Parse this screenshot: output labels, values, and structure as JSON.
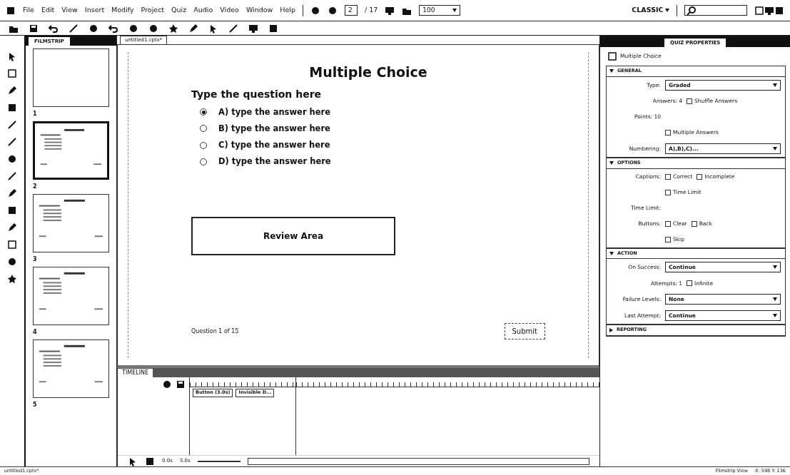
{
  "menu_bar": {
    "menus": [
      "File",
      "Edit",
      "View",
      "Insert",
      "Modify",
      "Project",
      "Quiz",
      "Audio",
      "Video",
      "Window",
      "Help"
    ],
    "slide_number": "2",
    "slide_total": "/ 17",
    "zoom": "100",
    "workspace": "CLASSIC"
  },
  "filmstrip": {
    "tab": "FILMSTRIP",
    "slides": [
      {
        "number": "1",
        "selected": false,
        "kind": "blank"
      },
      {
        "number": "2",
        "selected": true,
        "kind": "quiz"
      },
      {
        "number": "3",
        "selected": false,
        "kind": "quiz"
      },
      {
        "number": "4",
        "selected": false,
        "kind": "quiz"
      },
      {
        "number": "5",
        "selected": false,
        "kind": "quiz"
      }
    ]
  },
  "document_tab": "untitled1.cptx*",
  "slide": {
    "title": "Multiple Choice",
    "question": "Type the question here",
    "answers": [
      {
        "label": "A) type the answer here",
        "selected": true
      },
      {
        "label": "B) type the answer here",
        "selected": false
      },
      {
        "label": "C) type the answer here",
        "selected": false
      },
      {
        "label": "D) type the answer here",
        "selected": false
      }
    ],
    "review_area": "Review Area",
    "progress": "Question 1 of 15",
    "submit": "Submit"
  },
  "timeline": {
    "tab": "TIMELINE",
    "bars": [
      "Button (3.0s)",
      "Invisible D..."
    ],
    "time": "0.0s",
    "duration": "3.0s"
  },
  "quiz_properties": {
    "tab": "QUIZ PROPERTIES",
    "title": "Multiple Choice",
    "sections": [
      {
        "name": "GENERAL",
        "expanded": true,
        "rows": [
          {
            "kind": "select",
            "label": "Type:",
            "value": "Graded"
          },
          {
            "kind": "mixed",
            "label": "Answers: 4",
            "items": [
              {
                "label": "Shuffle Answers",
                "checked": false
              }
            ]
          },
          {
            "kind": "text",
            "label": "Points: 10"
          },
          {
            "kind": "checks",
            "items": [
              {
                "label": "Multiple Answers",
                "checked": false
              }
            ]
          },
          {
            "kind": "select",
            "label": "Numbering:",
            "value": "A),B),C)..."
          }
        ]
      },
      {
        "name": "OPTIONS",
        "expanded": true,
        "rows": [
          {
            "kind": "checks",
            "label": "Captions:",
            "items": [
              {
                "label": "Correct",
                "checked": false
              },
              {
                "label": "Incomplete",
                "checked": false
              }
            ]
          },
          {
            "kind": "checks",
            "items": [
              {
                "label": "Time Limit",
                "checked": false
              }
            ]
          },
          {
            "kind": "text",
            "label": "Time Limit:"
          },
          {
            "kind": "checks",
            "label": "Buttons:",
            "items": [
              {
                "label": "Clear",
                "checked": false
              },
              {
                "label": "Back",
                "checked": false
              }
            ]
          },
          {
            "kind": "checks",
            "items": [
              {
                "label": "Skip",
                "checked": false
              }
            ]
          }
        ]
      },
      {
        "name": "ACTION",
        "expanded": true,
        "rows": [
          {
            "kind": "select",
            "label": "On Success:",
            "value": "Continue"
          },
          {
            "kind": "mixed",
            "label": "Attempts: 1",
            "items": [
              {
                "label": "Infinite",
                "checked": false
              }
            ]
          },
          {
            "kind": "select",
            "label": "Failure Levels:",
            "value": "None"
          },
          {
            "kind": "select",
            "label": "Last Attempt:",
            "value": "Continue"
          }
        ]
      },
      {
        "name": "REPORTING",
        "expanded": false
      }
    ]
  },
  "status_bar": {
    "file": "untitled1.cptx*",
    "view": "Filmstrip View",
    "coords": "X: 598 Y: 136"
  }
}
